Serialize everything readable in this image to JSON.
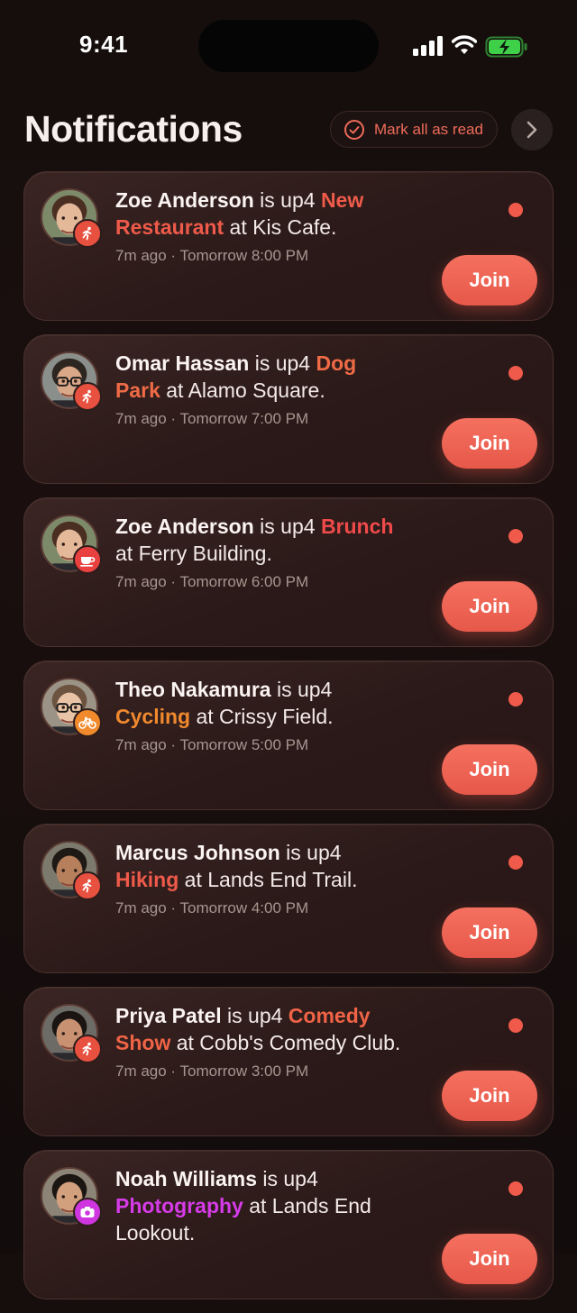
{
  "status_bar": {
    "time": "9:41"
  },
  "header": {
    "title": "Notifications",
    "mark_all_label": "Mark all as read"
  },
  "colors": {
    "accent": "#EF5A4A",
    "orange": "#F0892E",
    "magenta": "#D63BE8",
    "background": "#150E0D"
  },
  "notifications": [
    {
      "name": "Zoe Anderson",
      "verb": " is up4 ",
      "activity": "New Restaurant",
      "activity_color": "#EF5A4A",
      "rest": " at Kis Cafe.",
      "meta": "7m ago · Tomorrow 8:00 PM",
      "badge_icon": "running-icon",
      "badge_color": "#E8503F",
      "join": "Join"
    },
    {
      "name": "Omar Hassan",
      "verb": " is up4 ",
      "activity": "Dog Park",
      "activity_color": "#EF6B46",
      "rest": " at Alamo Square.",
      "meta": "7m ago · Tomorrow 7:00 PM",
      "badge_icon": "running-icon",
      "badge_color": "#E8503F",
      "join": "Join"
    },
    {
      "name": "Zoe Anderson",
      "verb": " is up4 ",
      "activity": "Brunch",
      "activity_color": "#EF4A4A",
      "rest": " at Ferry Building.",
      "meta": "7m ago · Tomorrow 6:00 PM",
      "badge_icon": "coffee-cup-icon",
      "badge_color": "#E8413F",
      "join": "Join"
    },
    {
      "name": "Theo Nakamura",
      "verb": " is up4 ",
      "activity": "Cycling",
      "activity_color": "#F0892E",
      "rest": " at Crissy Field.",
      "meta": "7m ago · Tomorrow 5:00 PM",
      "badge_icon": "bicycle-icon",
      "badge_color": "#F08A2C",
      "join": "Join"
    },
    {
      "name": "Marcus Johnson",
      "verb": " is up4 ",
      "activity": "Hiking",
      "activity_color": "#EF5A4A",
      "rest": " at Lands End Trail.",
      "meta": "7m ago · Tomorrow 4:00 PM",
      "badge_icon": "running-icon",
      "badge_color": "#E8503F",
      "join": "Join"
    },
    {
      "name": "Priya Patel",
      "verb": " is up4 ",
      "activity": "Comedy Show",
      "activity_color": "#EF6346",
      "rest": " at Cobb's Comedy Club.",
      "meta": "7m ago · Tomorrow 3:00 PM",
      "badge_icon": "running-icon",
      "badge_color": "#E8503F",
      "join": "Join"
    },
    {
      "name": "Noah Williams",
      "verb": " is up4 ",
      "activity": "Photography",
      "activity_color": "#D63BE8",
      "rest": " at Lands End Lookout.",
      "meta": "",
      "badge_icon": "camera-icon",
      "badge_color": "#CF36E0",
      "join": "Join"
    }
  ]
}
